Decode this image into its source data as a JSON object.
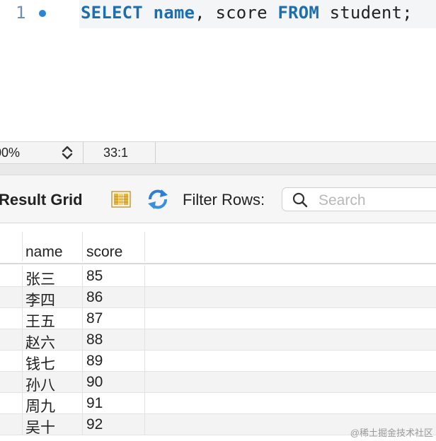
{
  "editor": {
    "line_number": "1",
    "tokens": [
      {
        "text": "SELECT",
        "kind": "keyword"
      },
      {
        "text": " ",
        "kind": "plain"
      },
      {
        "text": "name",
        "kind": "keyword"
      },
      {
        "text": ", score ",
        "kind": "plain"
      },
      {
        "text": "FROM",
        "kind": "keyword"
      },
      {
        "text": " student;",
        "kind": "plain"
      }
    ]
  },
  "statusbar": {
    "zoom": "00%",
    "cursor": "33:1"
  },
  "toolbar": {
    "title": "Result Grid",
    "filter_label": "Filter Rows:",
    "search_placeholder": "Search",
    "grid_icon": "result-grid-icon",
    "refresh_icon": "refresh-icon",
    "search_icon": "search-icon"
  },
  "grid": {
    "columns": [
      "name",
      "score"
    ],
    "rows": [
      {
        "name": "张三",
        "score": "85"
      },
      {
        "name": "李四",
        "score": "86"
      },
      {
        "name": "王五",
        "score": "87"
      },
      {
        "name": "赵六",
        "score": "88"
      },
      {
        "name": "钱七",
        "score": "89"
      },
      {
        "name": "孙八",
        "score": "90"
      },
      {
        "name": "周九",
        "score": "91"
      },
      {
        "name": "吴十",
        "score": "92"
      }
    ]
  },
  "watermark": "@稀土掘金技术社区",
  "colors": {
    "keyword": "#1b6fae",
    "breakpoint": "#2a84d8",
    "refresh_blue": "#2f7fd0",
    "grid_icon_yellow": "#e8b33a"
  }
}
